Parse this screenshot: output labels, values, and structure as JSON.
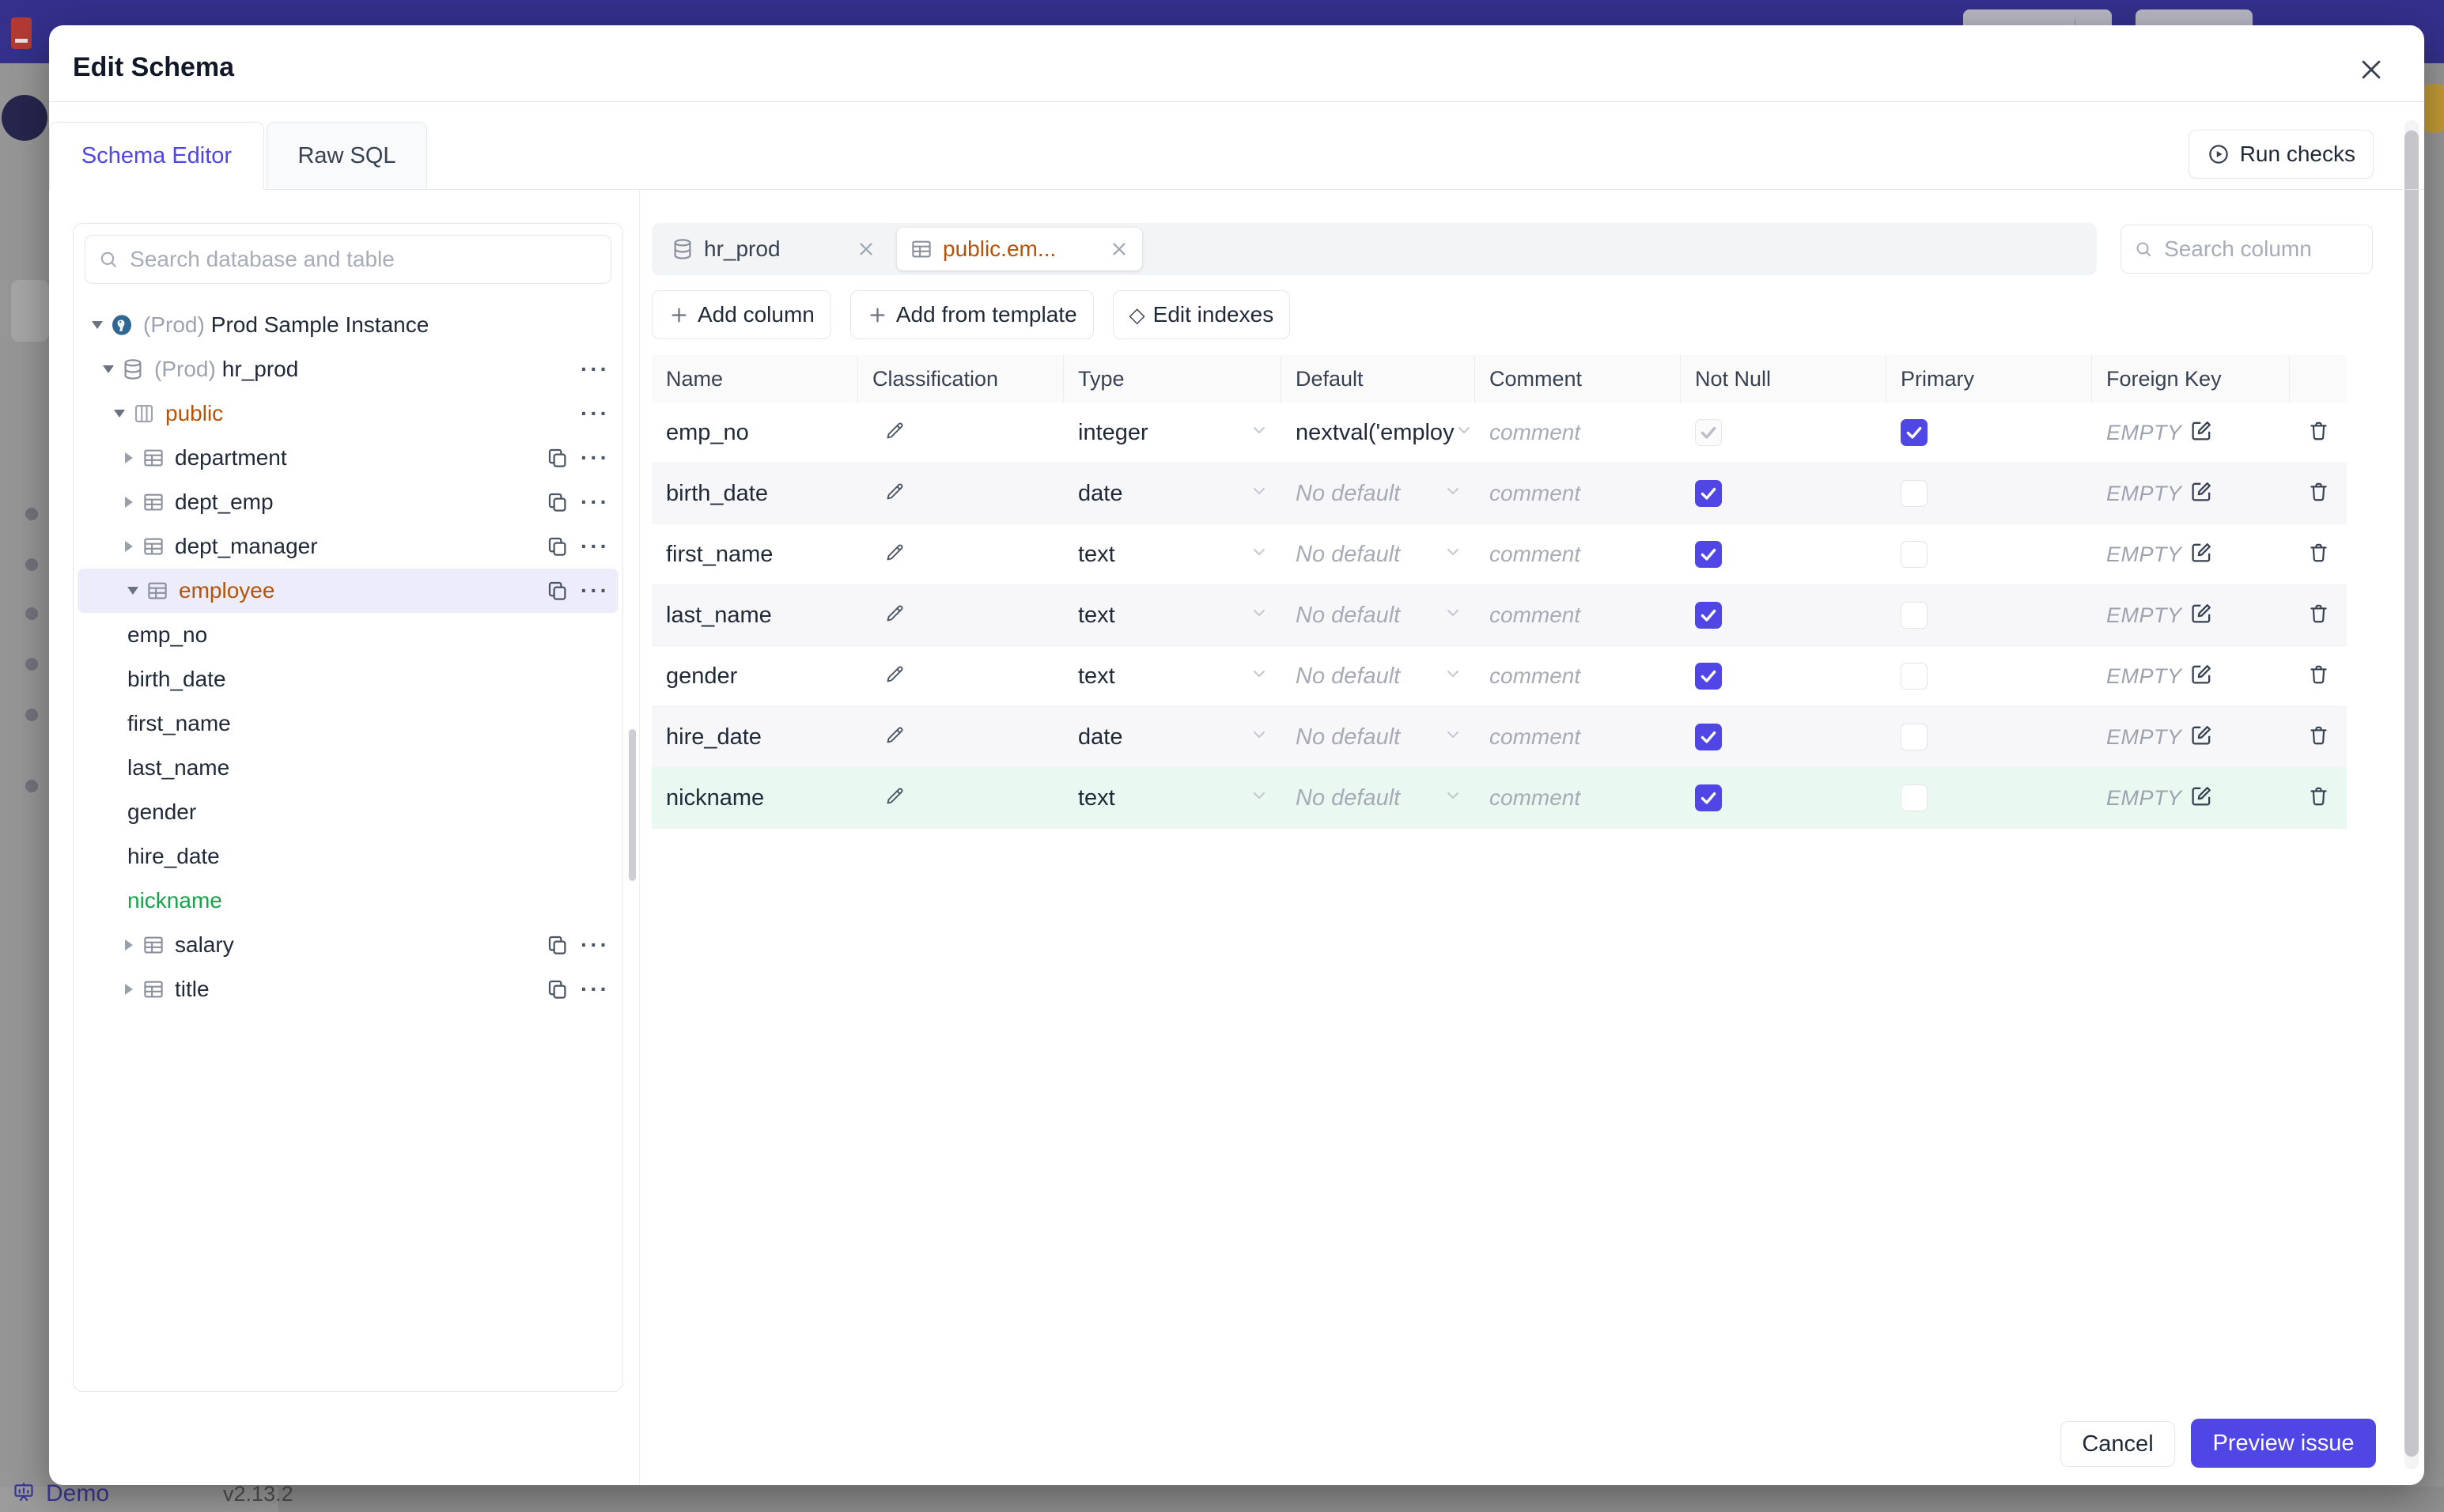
{
  "backdrop": {
    "demo_label": "Demo",
    "version": "v2.13.2"
  },
  "colors": {
    "accent": "#4f46e5",
    "amber": "#b45309",
    "green": "#16a34a",
    "topbar": "#34308c",
    "selected_tree_bg": "#ececfa",
    "new_row_bg": "#e9f8f0"
  },
  "modal": {
    "title": "Edit Schema",
    "tabs": [
      {
        "label": "Schema Editor",
        "active": true
      },
      {
        "label": "Raw SQL",
        "active": false
      }
    ],
    "run_checks_label": "Run checks",
    "sidebar": {
      "search_placeholder": "Search database and table",
      "tree": [
        {
          "level": 0,
          "caret": "down",
          "icon": "postgres",
          "prefix": "(Prod)",
          "label": "Prod Sample Instance",
          "trailing": []
        },
        {
          "level": 1,
          "caret": "down",
          "icon": "database",
          "prefix": "(Prod)",
          "label": "hr_prod",
          "trailing": [
            "more"
          ]
        },
        {
          "level": 2,
          "caret": "down",
          "icon": "schema",
          "label": "public",
          "color": "amber",
          "trailing": [
            "more"
          ]
        },
        {
          "level": 3,
          "caret": "right",
          "icon": "table",
          "label": "department",
          "trailing": [
            "copy",
            "more"
          ]
        },
        {
          "level": 3,
          "caret": "right",
          "icon": "table",
          "label": "dept_emp",
          "trailing": [
            "copy",
            "more"
          ]
        },
        {
          "level": 3,
          "caret": "right",
          "icon": "table",
          "label": "dept_manager",
          "trailing": [
            "copy",
            "more"
          ]
        },
        {
          "level": 3,
          "caret": "down",
          "icon": "table",
          "label": "employee",
          "color": "amber",
          "selected": true,
          "trailing": [
            "copy",
            "more"
          ]
        },
        {
          "level": 4,
          "label": "emp_no"
        },
        {
          "level": 4,
          "label": "birth_date"
        },
        {
          "level": 4,
          "label": "first_name"
        },
        {
          "level": 4,
          "label": "last_name"
        },
        {
          "level": 4,
          "label": "gender"
        },
        {
          "level": 4,
          "label": "hire_date"
        },
        {
          "level": 4,
          "label": "nickname",
          "color": "green"
        },
        {
          "level": 3,
          "caret": "right",
          "icon": "table",
          "label": "salary",
          "trailing": [
            "copy",
            "more"
          ]
        },
        {
          "level": 3,
          "caret": "right",
          "icon": "table",
          "label": "title",
          "trailing": [
            "copy",
            "more"
          ]
        }
      ]
    },
    "editor": {
      "chips": [
        {
          "icon": "database",
          "label": "hr_prod",
          "active": false
        },
        {
          "icon": "table",
          "label": "public.em...",
          "active": true
        }
      ],
      "search_placeholder": "Search column",
      "actions": [
        {
          "icon": "plus",
          "label": "Add column"
        },
        {
          "icon": "plus",
          "label": "Add from template"
        },
        {
          "icon": "diamond",
          "label": "Edit indexes"
        }
      ],
      "table": {
        "headers": [
          "Name",
          "Classification",
          "Type",
          "Default",
          "Comment",
          "Not Null",
          "Primary",
          "Foreign Key"
        ],
        "rows": [
          {
            "name": "emp_no",
            "type": "integer",
            "default": "nextval('employ",
            "default_placeholder": false,
            "comment": "comment",
            "not_null": "checked-disabled",
            "primary": "checked",
            "foreign_key": "EMPTY",
            "variant": "odd"
          },
          {
            "name": "birth_date",
            "type": "date",
            "default": "No default",
            "default_placeholder": true,
            "comment": "comment",
            "not_null": "checked",
            "primary": "unchecked",
            "foreign_key": "EMPTY",
            "variant": "even"
          },
          {
            "name": "first_name",
            "type": "text",
            "default": "No default",
            "default_placeholder": true,
            "comment": "comment",
            "not_null": "checked",
            "primary": "unchecked",
            "foreign_key": "EMPTY",
            "variant": "odd"
          },
          {
            "name": "last_name",
            "type": "text",
            "default": "No default",
            "default_placeholder": true,
            "comment": "comment",
            "not_null": "checked",
            "primary": "unchecked",
            "foreign_key": "EMPTY",
            "variant": "even"
          },
          {
            "name": "gender",
            "type": "text",
            "default": "No default",
            "default_placeholder": true,
            "comment": "comment",
            "not_null": "checked",
            "primary": "unchecked",
            "foreign_key": "EMPTY",
            "variant": "odd"
          },
          {
            "name": "hire_date",
            "type": "date",
            "default": "No default",
            "default_placeholder": true,
            "comment": "comment",
            "not_null": "checked",
            "primary": "unchecked",
            "foreign_key": "EMPTY",
            "variant": "even"
          },
          {
            "name": "nickname",
            "type": "text",
            "default": "No default",
            "default_placeholder": true,
            "comment": "comment",
            "not_null": "checked",
            "primary": "unchecked",
            "foreign_key": "EMPTY",
            "variant": "new"
          }
        ]
      }
    },
    "footer": {
      "cancel": "Cancel",
      "primary": "Preview issue"
    }
  }
}
